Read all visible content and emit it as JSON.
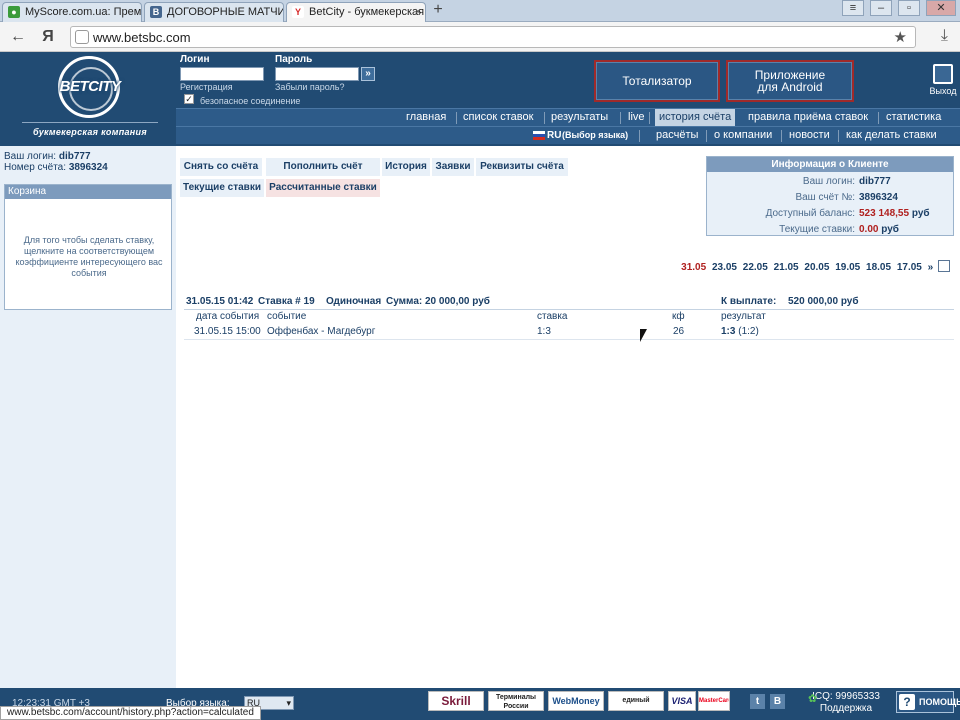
{
  "browser": {
    "tabs": [
      {
        "title": "MyScore.com.ua: Прем",
        "active": false,
        "favicon_color": "#3b9b3b"
      },
      {
        "title": "ДОГОВОРНЫЕ МАТЧИ |",
        "active": false,
        "favicon_color": "#45668e"
      },
      {
        "title": "BetCity - букмекерская",
        "active": true,
        "favicon_color": "#d62828"
      }
    ],
    "new_tab_icon": "+",
    "url": "www.betsbc.com",
    "status_url": "www.betsbc.com/account/history.php?action=calculated"
  },
  "header": {
    "logo_text": "BETCITY",
    "logo_tagline": "букмекерская компания",
    "login_label": "Логин",
    "password_label": "Пароль",
    "register_link": "Регистрация",
    "forgot_link": "Забыли пароль?",
    "secure_label": "безопасное соединение",
    "secure_checked": true,
    "btn_tote": "Тотализатор",
    "btn_android_line1": "Приложение",
    "btn_android_line2": "для Android",
    "exit_label": "Выход"
  },
  "nav": {
    "main": [
      "главная",
      "список ставок",
      "результаты",
      "live",
      "история счёта",
      "правила приёма ставок",
      "статистика"
    ],
    "active": "история счёта",
    "secondary": {
      "lang_code": "RU",
      "lang_hint": "(Выбор языка)",
      "items": [
        "расчёты",
        "о компании",
        "новости",
        "как делать ставки"
      ]
    }
  },
  "user": {
    "login_label": "Ваш логин:",
    "login_value": "dib777",
    "account_label": "Номер счёта:",
    "account_value": "3896324"
  },
  "cart": {
    "title": "Корзина",
    "text": "Для того чтобы сделать ставку, щелкните на соответствующем коэффициенте интересующего вас события"
  },
  "account_tabs": {
    "row1": [
      "Снять со счёта",
      "Пополнить счёт",
      "История",
      "Заявки",
      "Реквизиты счёта"
    ],
    "row2": [
      "Текущие ставки",
      "Рассчитанные ставки"
    ],
    "active": "Рассчитанные ставки"
  },
  "client_info": {
    "title": "Информация о Клиенте",
    "login_label": "Ваш логин:",
    "login_value": "dib777",
    "account_label": "Ваш счёт №:",
    "account_value": "3896324",
    "balance_label": "Доступный баланс:",
    "balance_value": "523 148,55",
    "balance_currency": "руб",
    "current_bets_label": "Текущие ставки:",
    "current_bets_value": "0.00",
    "current_bets_currency": "руб"
  },
  "dates": {
    "current": "31.05",
    "others": [
      "23.05",
      "22.05",
      "21.05",
      "20.05",
      "19.05",
      "18.05",
      "17.05"
    ],
    "more": "»"
  },
  "bet": {
    "datetime": "31.05.15 01:42",
    "number": "Ставка # 19",
    "type": "Одиночная",
    "amount": "Сумма: 20 000,00 руб",
    "payout_label": "К выплате:",
    "payout_value": "520 000,00 руб",
    "columns": {
      "date": "дата события",
      "event": "событие",
      "stake": "ставка",
      "coef": "кф",
      "result": "результат"
    },
    "rows": [
      {
        "date": "31.05.15 15:00",
        "event": "Оффенбах - Магдебург",
        "stake": "1:3",
        "coef": "26",
        "result": "1:3",
        "result_extra": "(1:2)"
      }
    ]
  },
  "footer": {
    "clock": "12:23:31 GMT +3",
    "lang_label": "Выбор языка:",
    "lang_value": "RU",
    "payments": [
      "Skrill",
      "Терминалы России",
      "WebMoney",
      "единый кошелек",
      "VISA",
      "MasterCard"
    ],
    "icq_label": "ICQ: 99965333",
    "support_label": "Поддержка",
    "help_label": "ПОМОЩЬ"
  }
}
